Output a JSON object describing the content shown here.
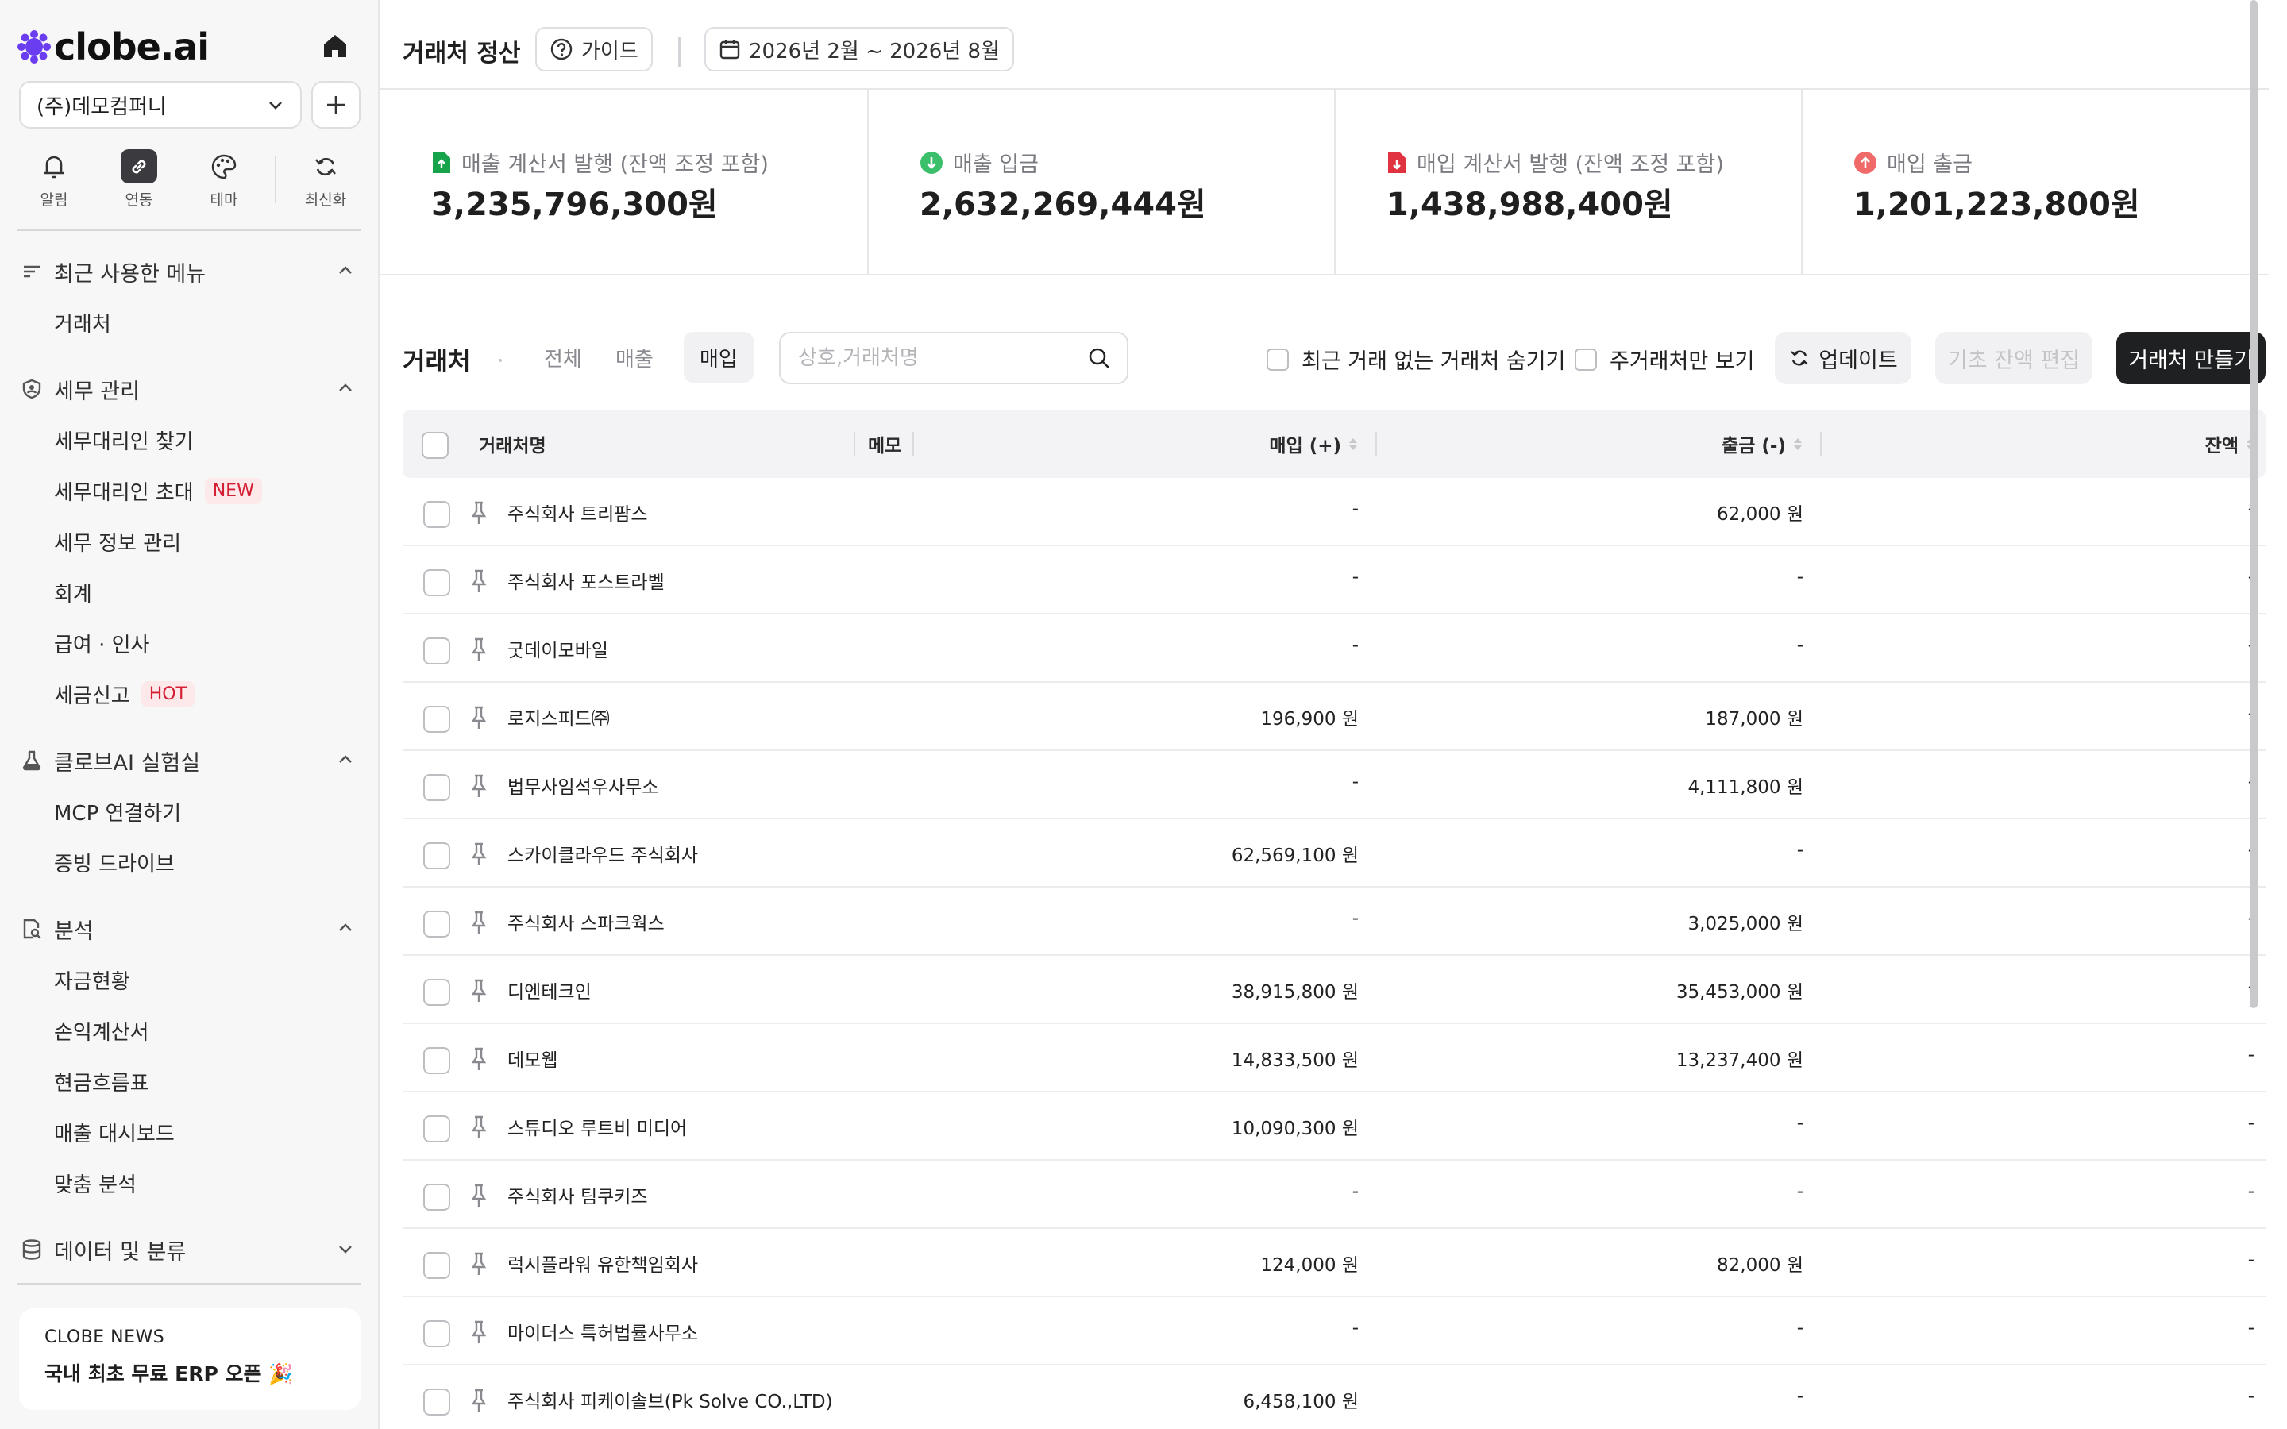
{
  "sidebar": {
    "brand": "clobe.ai",
    "company": "(주)데모컴퍼니",
    "tools": [
      {
        "label": "알림",
        "icon": "bell-icon"
      },
      {
        "label": "연동",
        "icon": "link-icon"
      },
      {
        "label": "테마",
        "icon": "palette-icon"
      },
      {
        "label": "최신화",
        "icon": "refresh-icon"
      }
    ],
    "sections": [
      {
        "title": "최근 사용한 메뉴",
        "icon": "lines-icon",
        "items": [
          {
            "label": "거래처"
          }
        ]
      },
      {
        "title": "세무 관리",
        "icon": "shield-icon",
        "items": [
          {
            "label": "세무대리인 찾기"
          },
          {
            "label": "세무대리인 초대",
            "badge": "NEW"
          },
          {
            "label": "세무 정보 관리"
          },
          {
            "label": "회계"
          },
          {
            "label": "급여 · 인사"
          },
          {
            "label": "세금신고",
            "badge": "HOT"
          }
        ]
      },
      {
        "title": "클로브AI 실험실",
        "icon": "flask-icon",
        "items": [
          {
            "label": "MCP 연결하기"
          },
          {
            "label": "증빙 드라이브"
          }
        ]
      },
      {
        "title": "분석",
        "icon": "doc-search-icon",
        "items": [
          {
            "label": "자금현황"
          },
          {
            "label": "손익계산서"
          },
          {
            "label": "현금흐름표"
          },
          {
            "label": "매출 대시보드"
          },
          {
            "label": "맞춤 분석"
          }
        ]
      },
      {
        "title": "데이터 및 분류",
        "icon": "database-icon",
        "items": []
      }
    ],
    "news": {
      "kicker": "CLOBE NEWS",
      "headline": "국내 최초 무료 ERP 오픈 🎉"
    }
  },
  "header": {
    "title": "거래처 정산",
    "guide": "가이드",
    "date_range": "2026년 2월 ~ 2026년 8월"
  },
  "stats": [
    {
      "label": "매출 계산서 발행 (잔액 조정 포함)",
      "value": "3,235,796,300원",
      "icon": "doc-up-icon",
      "color": "#17a34a"
    },
    {
      "label": "매출 입금",
      "value": "2,632,269,444원",
      "icon": "arrow-down-circle-icon",
      "color": "#3bbf6a"
    },
    {
      "label": "매입 계산서 발행 (잔액 조정 포함)",
      "value": "1,438,988,400원",
      "icon": "doc-down-icon",
      "color": "#e0323f"
    },
    {
      "label": "매입 출금",
      "value": "1,201,223,800원",
      "icon": "arrow-up-circle-icon",
      "color": "#f06a6a"
    }
  ],
  "toolbar": {
    "title": "거래처",
    "tabs": [
      "전체",
      "매출",
      "매입"
    ],
    "active_tab": "매입",
    "search_placeholder": "상호,거래처명",
    "hide_inactive": "최근 거래 없는 거래처 숨기기",
    "main_only": "주거래처만 보기",
    "update": "업데이트",
    "edit_balance": "기초 잔액 편집",
    "create": "거래처 만들기"
  },
  "table": {
    "columns": [
      "거래처명",
      "메모",
      "매입 (+)",
      "출금 (-)",
      "잔액"
    ],
    "rows": [
      {
        "name": "주식회사 트리팜스",
        "purchase": "-",
        "withdraw": "62,000 원",
        "balance": "-"
      },
      {
        "name": "주식회사 포스트라벨",
        "purchase": "-",
        "withdraw": "-",
        "balance": "-"
      },
      {
        "name": "굿데이모바일",
        "purchase": "-",
        "withdraw": "-",
        "balance": "-"
      },
      {
        "name": "로지스피드㈜",
        "purchase": "196,900 원",
        "withdraw": "187,000 원",
        "balance": "-"
      },
      {
        "name": "법무사임석우사무소",
        "purchase": "-",
        "withdraw": "4,111,800 원",
        "balance": "-"
      },
      {
        "name": "스카이클라우드 주식회사",
        "purchase": "62,569,100 원",
        "withdraw": "-",
        "balance": "-"
      },
      {
        "name": "주식회사 스파크웍스",
        "purchase": "-",
        "withdraw": "3,025,000 원",
        "balance": "-"
      },
      {
        "name": "디엔테크인",
        "purchase": "38,915,800 원",
        "withdraw": "35,453,000 원",
        "balance": "-"
      },
      {
        "name": "데모웹",
        "purchase": "14,833,500 원",
        "withdraw": "13,237,400 원",
        "balance": "-"
      },
      {
        "name": "스튜디오 루트비 미디어",
        "purchase": "10,090,300 원",
        "withdraw": "-",
        "balance": "-"
      },
      {
        "name": "주식회사 팀쿠키즈",
        "purchase": "-",
        "withdraw": "-",
        "balance": "-"
      },
      {
        "name": "럭시플라워 유한책임회사",
        "purchase": "124,000 원",
        "withdraw": "82,000 원",
        "balance": "-"
      },
      {
        "name": "마이더스 특허법률사무소",
        "purchase": "-",
        "withdraw": "-",
        "balance": "-"
      },
      {
        "name": "주식회사 피케이솔브(Pk Solve CO.,LTD)",
        "purchase": "6,458,100 원",
        "withdraw": "-",
        "balance": "-"
      }
    ]
  }
}
